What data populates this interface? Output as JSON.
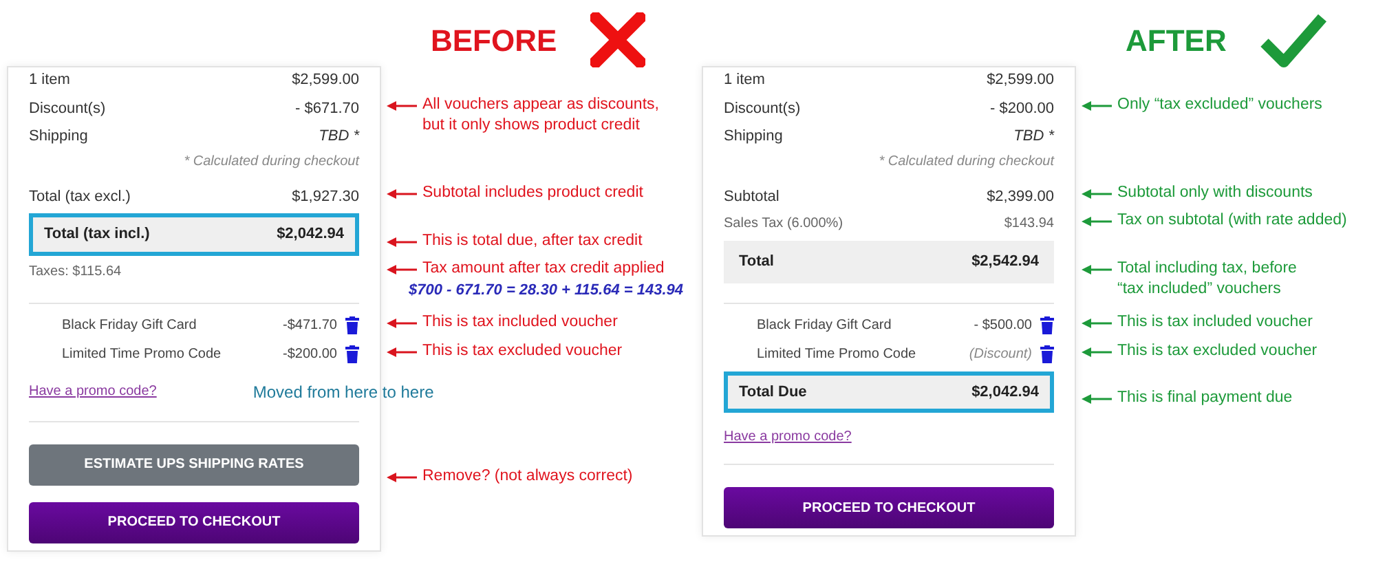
{
  "panels": [
    {
      "heading": "BEFORE",
      "kind": "cross",
      "rows": [
        {
          "kind": "line",
          "label": "1 item",
          "value": "$2,599.00"
        },
        {
          "kind": "line",
          "label": "Discount(s)",
          "value": "- $671.70",
          "annotation": [
            "All vouchers appear as discounts,",
            "but it only shows product credit"
          ]
        },
        {
          "kind": "line",
          "label": "Shipping",
          "value": "TBD *",
          "italic": true
        },
        {
          "kind": "note",
          "label": "* Calculated during checkout"
        },
        {
          "kind": "line",
          "label": "Total (tax excl.)",
          "value": "$1,927.30",
          "annotation": "Subtotal includes product credit"
        },
        {
          "kind": "total",
          "label": "Total (tax incl.)",
          "value": "$2,042.94",
          "boxed": true,
          "annotation": "This is total due, after tax credit"
        },
        {
          "kind": "minor",
          "label": "Taxes: $115.64",
          "annotation": "Tax amount after tax credit applied",
          "formula": "$700 - 671.70 = 28.30 + 115.64 = 143.94"
        },
        {
          "kind": "voucher",
          "label": "Black Friday Gift Card",
          "value": "-$471.70",
          "rule_above": true,
          "annotation": "This is tax included voucher"
        },
        {
          "kind": "voucher",
          "label": "Limited Time Promo Code",
          "value": "-$200.00",
          "annotation": "This is tax excluded voucher"
        },
        {
          "kind": "link",
          "label": "Have a promo code?",
          "note": "Moved from here to here"
        },
        {
          "kind": "secondary",
          "label": "ESTIMATE UPS SHIPPING RATES",
          "rule_above": true,
          "annotation": "Remove? (not always correct)"
        },
        {
          "kind": "primary",
          "label": "PROCEED TO CHECKOUT"
        }
      ]
    },
    {
      "heading": "AFTER",
      "kind": "check",
      "rows": [
        {
          "kind": "line",
          "label": "1 item",
          "value": "$2,599.00"
        },
        {
          "kind": "line",
          "label": "Discount(s)",
          "value": "- $200.00",
          "annotation": "Only “tax excluded” vouchers"
        },
        {
          "kind": "line",
          "label": "Shipping",
          "value": "TBD *",
          "italic": true
        },
        {
          "kind": "note",
          "label": "* Calculated during checkout"
        },
        {
          "kind": "line",
          "label": "Subtotal",
          "value": "$2,399.00",
          "annotation": "Subtotal only with discounts"
        },
        {
          "kind": "minor",
          "label": "Sales Tax (6.000%)",
          "value": "$143.94",
          "annotation": "Tax on subtotal (with rate added)"
        },
        {
          "kind": "total",
          "label": "Total",
          "value": "$2,542.94",
          "boxed": false,
          "annotation": [
            "Total including tax, before",
            "“tax included” vouchers"
          ]
        },
        {
          "kind": "voucher",
          "label": "Black Friday Gift Card",
          "value": "- $500.00",
          "rule_above": true,
          "annotation": "This is tax included voucher"
        },
        {
          "kind": "voucher",
          "label": "Limited Time Promo Code",
          "value": "(Discount)",
          "italic": true,
          "annotation": "This is tax excluded voucher"
        },
        {
          "kind": "total",
          "label": "Total Due",
          "value": "$2,042.94",
          "boxed": true,
          "annotation": "This is final payment due"
        },
        {
          "kind": "link",
          "label": "Have a promo code?"
        },
        {
          "kind": "primary",
          "label": "PROCEED TO CHECKOUT",
          "rule_above": true
        }
      ]
    }
  ]
}
